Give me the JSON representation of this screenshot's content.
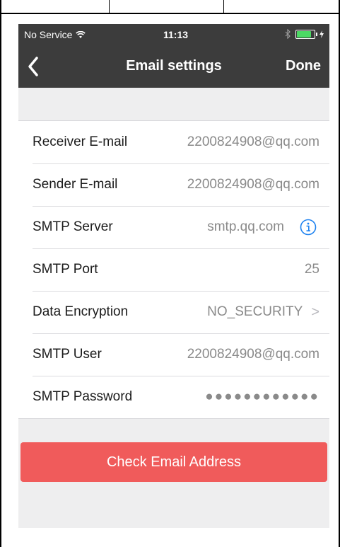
{
  "status_bar": {
    "carrier": "No Service",
    "time": "11:13",
    "wifi_icon": "wifi-icon",
    "bluetooth_icon": "bluetooth-icon",
    "battery_icon": "battery-icon",
    "battery_color": "#4cd964"
  },
  "nav": {
    "title": "Email settings",
    "done_label": "Done",
    "back_icon": "chevron-left-icon",
    "background": "#3c3c3c"
  },
  "settings": [
    {
      "label": "Receiver E-mail",
      "value": "2200824908@qq.com"
    },
    {
      "label": "Sender E-mail",
      "value": "2200824908@qq.com"
    },
    {
      "label": "SMTP Server",
      "value": "smtp.qq.com",
      "icon": "info-icon"
    },
    {
      "label": "SMTP Port",
      "value": "25"
    },
    {
      "label": "Data Encryption",
      "value": "NO_SECURITY",
      "chevron": ">"
    },
    {
      "label": "SMTP User",
      "value": "2200824908@qq.com"
    },
    {
      "label": "SMTP Password",
      "value": "●●●●●●●●●●●●"
    }
  ],
  "check_button": {
    "label": "Check Email Address",
    "color": "#f05b5b"
  },
  "accent": "#1e82f0"
}
